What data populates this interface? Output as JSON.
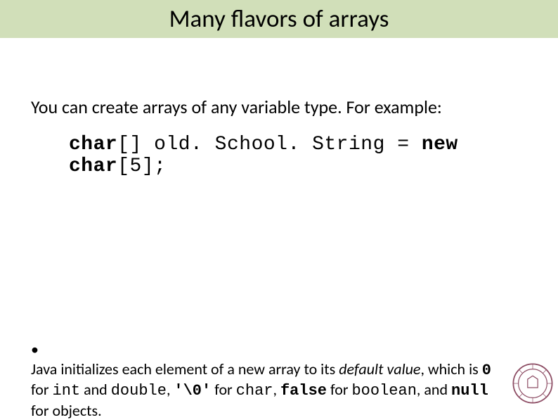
{
  "title": "Many flavors of arrays",
  "intro": "You can create arrays of any variable type.  For example:",
  "code": {
    "kw_char": "char",
    "brackets": "[] ",
    "ident": "old. School. String = ",
    "kw_new": "new char",
    "tail": "[5];"
  },
  "bullet": {
    "lead": "Java initializes each element of a new array to its ",
    "default_value": "default value",
    "after_default": ", which is ",
    "zero": "0",
    "for_int_and": " for ",
    "int_kw": "int",
    "and_word": " and  ",
    "double_kw": "double",
    "comma_sq": ", ",
    "nullchar": "'\\0'",
    "for_char": " for ",
    "char_kw": "char",
    "comma2": ", ",
    "false_kw": "false",
    "for_bool": " for ",
    "bool_kw": "boolean",
    "and_null": ", and ",
    "null_kw": "null",
    "for_obj": " for objects."
  }
}
